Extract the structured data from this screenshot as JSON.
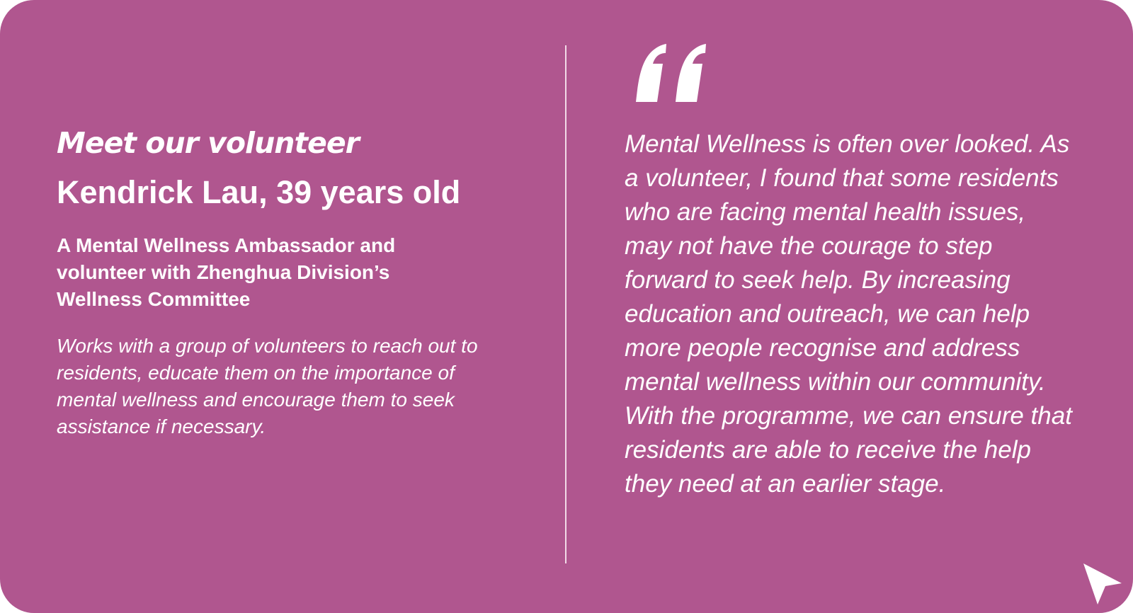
{
  "profile": {
    "eyebrow": "Meet our volunteer",
    "name": "Kendrick Lau, 39 years old",
    "role": "A Mental Wellness Ambassador and volunteer with Zhenghua Division’s Wellness Committee",
    "description": "Works with a group of volunteers to reach out to residents, educate them on the importance of mental wellness and encourage them to seek assistance if necessary."
  },
  "quote": {
    "icon": "quote-mark-icon",
    "text": "Mental Wellness is often over looked. As a volunteer, I found that some residents who are facing mental health issues, may not have the courage to step forward to seek help. By increasing education and outreach, we can help more people recognise and address mental wellness within our community. With the programme, we can ensure that residents are able to receive the help they need at an earlier stage."
  },
  "decoration": {
    "corner_icon": "cursor-arrow-icon"
  },
  "colors": {
    "background": "#b0568f",
    "text": "#ffffff",
    "divider": "#f3dbe8"
  }
}
